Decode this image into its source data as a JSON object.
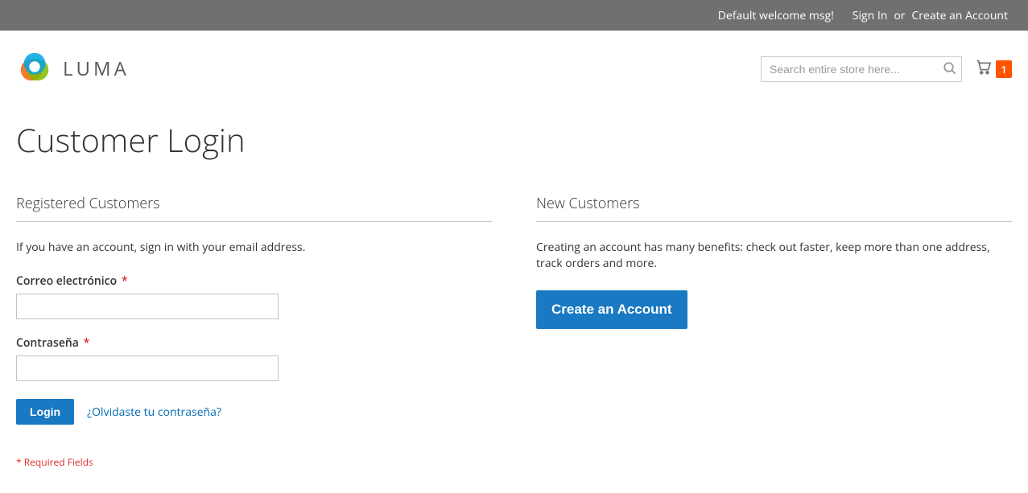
{
  "topbar": {
    "welcome": "Default welcome msg!",
    "signin": "Sign In",
    "or": "or",
    "create": "Create an Account"
  },
  "header": {
    "logo_text": "LUMA",
    "search_placeholder": "Search entire store here...",
    "cart_count": "1"
  },
  "page": {
    "title": "Customer Login"
  },
  "login_block": {
    "title": "Registered Customers",
    "desc": "If you have an account, sign in with your email address.",
    "email_label": "Correo electrónico",
    "password_label": "Contraseña",
    "asterisk": "*",
    "login_button": "Login",
    "forgot_link": "¿Olvidaste tu contraseña?",
    "required_note": "* Required Fields"
  },
  "new_block": {
    "title": "New Customers",
    "desc": "Creating an account has many benefits: check out faster, keep more than one address, track orders and more.",
    "create_button": "Create an Account"
  }
}
